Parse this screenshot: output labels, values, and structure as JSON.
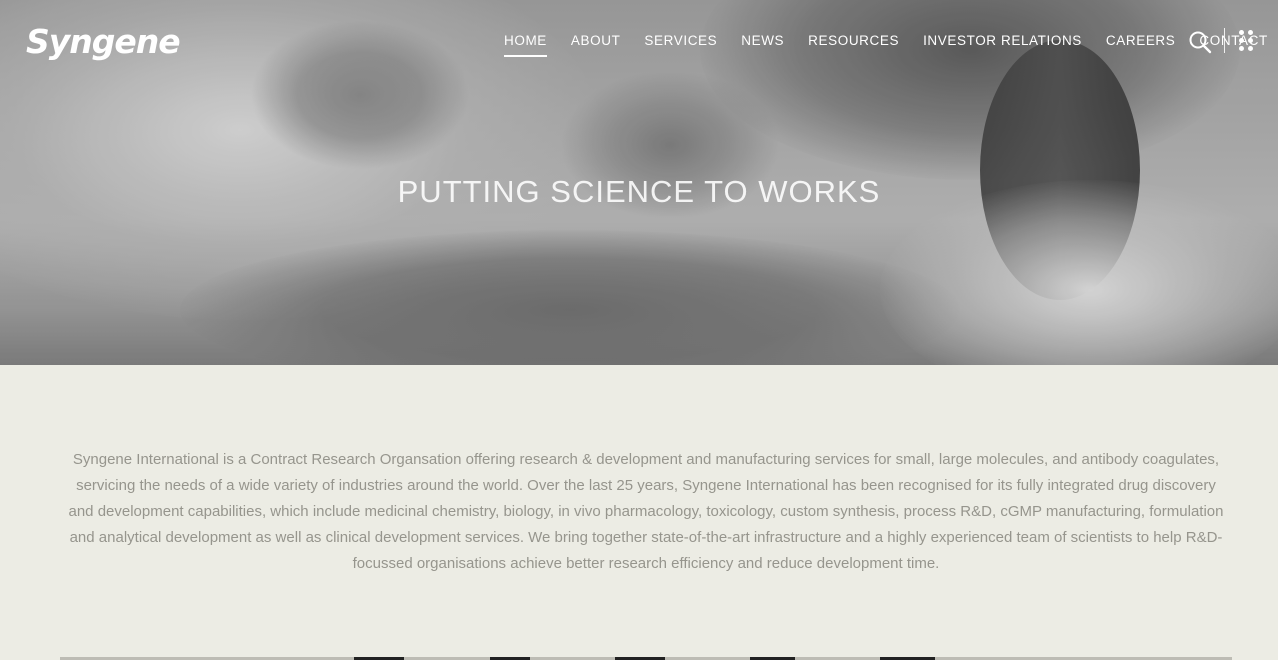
{
  "brand": {
    "logo_text": "Syngene"
  },
  "nav": {
    "items": [
      {
        "label": "HOME",
        "active": true
      },
      {
        "label": "ABOUT"
      },
      {
        "label": "SERVICES"
      },
      {
        "label": "NEWS"
      },
      {
        "label": "RESOURCES"
      },
      {
        "label": "INVESTOR RELATIONS"
      },
      {
        "label": "CAREERS"
      },
      {
        "label": "CONTACT"
      }
    ],
    "search_icon": "search-icon",
    "menu_icon": "grid-dots-icon"
  },
  "hero": {
    "title": "PUTTING SCIENCE TO WORKS"
  },
  "intro": {
    "text": "Syngene International is a Contract Research Organsation offering research & development and manufacturing services for small, large molecules, and antibody coagulates, servicing the needs of a wide variety of industries around the world. Over the last 25 years, Syngene International has been recognised for its fully integrated drug discovery and development capabilities, which include medicinal chemistry, biology, in vivo pharmacology, toxicology, custom synthesis, process R&D, cGMP manufacturing, formulation and analytical development as well as clinical development services. We bring together state-of-the-art infrastructure and a highly experienced team of scientists to help R&D-focussed organisations achieve better research efficiency and reduce development time."
  },
  "colors": {
    "page_bg": "#ecece4",
    "body_text": "#96958d",
    "nav_text": "#ffffff"
  }
}
